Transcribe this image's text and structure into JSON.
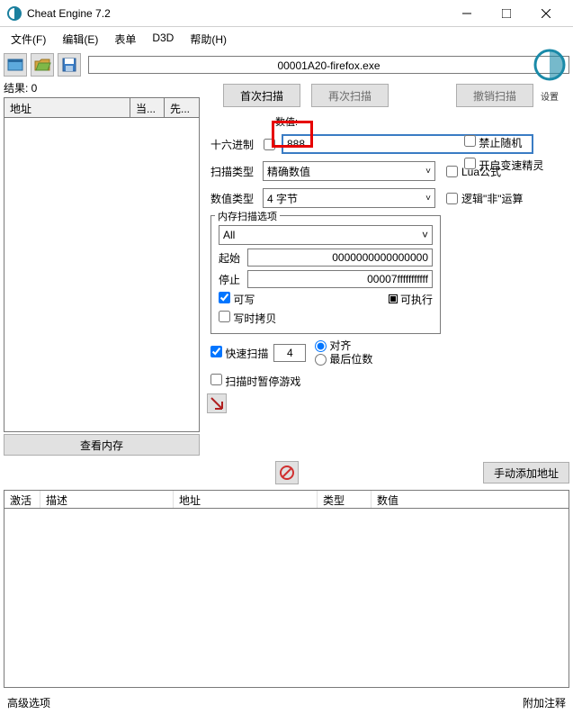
{
  "titlebar": {
    "title": "Cheat Engine 7.2"
  },
  "menu": {
    "file": "文件(F)",
    "edit": "编辑(E)",
    "table": "表单",
    "d3d": "D3D",
    "help": "帮助(H)"
  },
  "process": {
    "name": "00001A20-firefox.exe"
  },
  "settings_label": "设置",
  "results": {
    "count_label": "结果: 0",
    "col_addr": "地址",
    "col_cur": "当...",
    "col_prev": "先..."
  },
  "buttons": {
    "view_mem": "查看内存",
    "first_scan": "首次扫描",
    "next_scan": "再次扫描",
    "undo_scan": "撤销扫描",
    "add_addr": "手动添加地址"
  },
  "value_section": {
    "label": "数值:",
    "hex": "十六进制",
    "input_value": "888"
  },
  "scan_type": {
    "label": "扫描类型",
    "selected": "精确数值",
    "lua": "Lua公式"
  },
  "value_type": {
    "label": "数值类型",
    "selected": "4 字节",
    "not_op": "逻辑\"非\"运算"
  },
  "mem_options": {
    "title": "内存扫描选项",
    "all": "All",
    "start_label": "起始",
    "start_value": "0000000000000000",
    "stop_label": "停止",
    "stop_value": "00007fffffffffff",
    "writable": "可写",
    "executable": "可执行",
    "copy_on_write": "写时拷贝",
    "fast_scan": "快速扫描",
    "fast_value": "4",
    "align": "对齐",
    "last_digits": "最后位数",
    "pause_game": "扫描时暂停游戏"
  },
  "side_checks": {
    "no_random": "禁止随机",
    "speedhack": "开启变速精灵"
  },
  "bottom_table": {
    "active": "激活",
    "desc": "描述",
    "addr": "地址",
    "type": "类型",
    "value": "数值"
  },
  "footer": {
    "adv": "高级选项",
    "comment": "附加注释"
  }
}
